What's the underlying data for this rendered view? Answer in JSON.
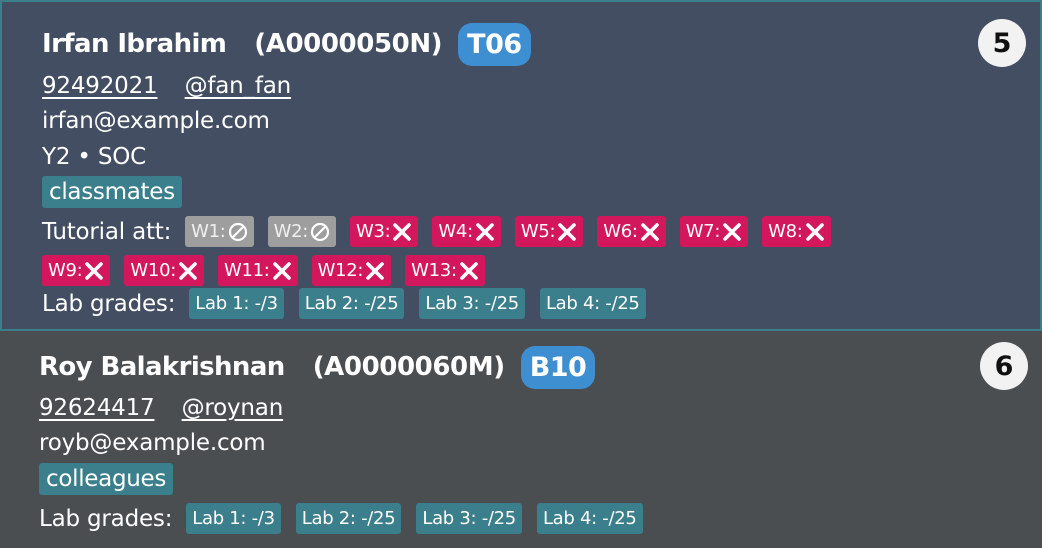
{
  "students": [
    {
      "index": "5",
      "name": "Irfan Ibrahim",
      "matric": "(A0000050N)",
      "tutorial": "T06",
      "phone": "92492021",
      "telegram": "@fan_fan",
      "email": "irfan@example.com",
      "year_faculty": "Y2 • SOC",
      "tag": "classmates",
      "attendance_label": "Tutorial att:",
      "attendance": [
        {
          "week": "W1:",
          "status": "excused"
        },
        {
          "week": "W2:",
          "status": "excused"
        },
        {
          "week": "W3:",
          "status": "absent"
        },
        {
          "week": "W4:",
          "status": "absent"
        },
        {
          "week": "W5:",
          "status": "absent"
        },
        {
          "week": "W6:",
          "status": "absent"
        },
        {
          "week": "W7:",
          "status": "absent"
        },
        {
          "week": "W8:",
          "status": "absent"
        },
        {
          "week": "W9:",
          "status": "absent"
        },
        {
          "week": "W10:",
          "status": "absent"
        },
        {
          "week": "W11:",
          "status": "absent"
        },
        {
          "week": "W12:",
          "status": "absent"
        },
        {
          "week": "W13:",
          "status": "absent"
        }
      ],
      "lab_label": "Lab grades:",
      "labs": [
        "Lab 1: -/3",
        "Lab 2: -/25",
        "Lab 3: -/25",
        "Lab 4: -/25"
      ]
    },
    {
      "index": "6",
      "name": "Roy Balakrishnan",
      "matric": "(A0000060M)",
      "tutorial": "B10",
      "phone": "92624417",
      "telegram": "@roynan",
      "email": "royb@example.com",
      "tag": "colleagues",
      "lab_label": "Lab grades:",
      "labs": [
        "Lab 1: -/3",
        "Lab 2: -/25",
        "Lab 3: -/25",
        "Lab 4: -/25"
      ]
    }
  ],
  "colors": {
    "selected_card_bg": "#434e63",
    "card_bg": "#4b4e51",
    "tutorial_badge": "#3e8fd1",
    "tag_chip": "#3b7e8c",
    "absent": "#d2175c",
    "excused": "#9e9e9e"
  },
  "icons": {
    "excused": "prohibited-circle-icon",
    "absent": "cross-icon"
  }
}
